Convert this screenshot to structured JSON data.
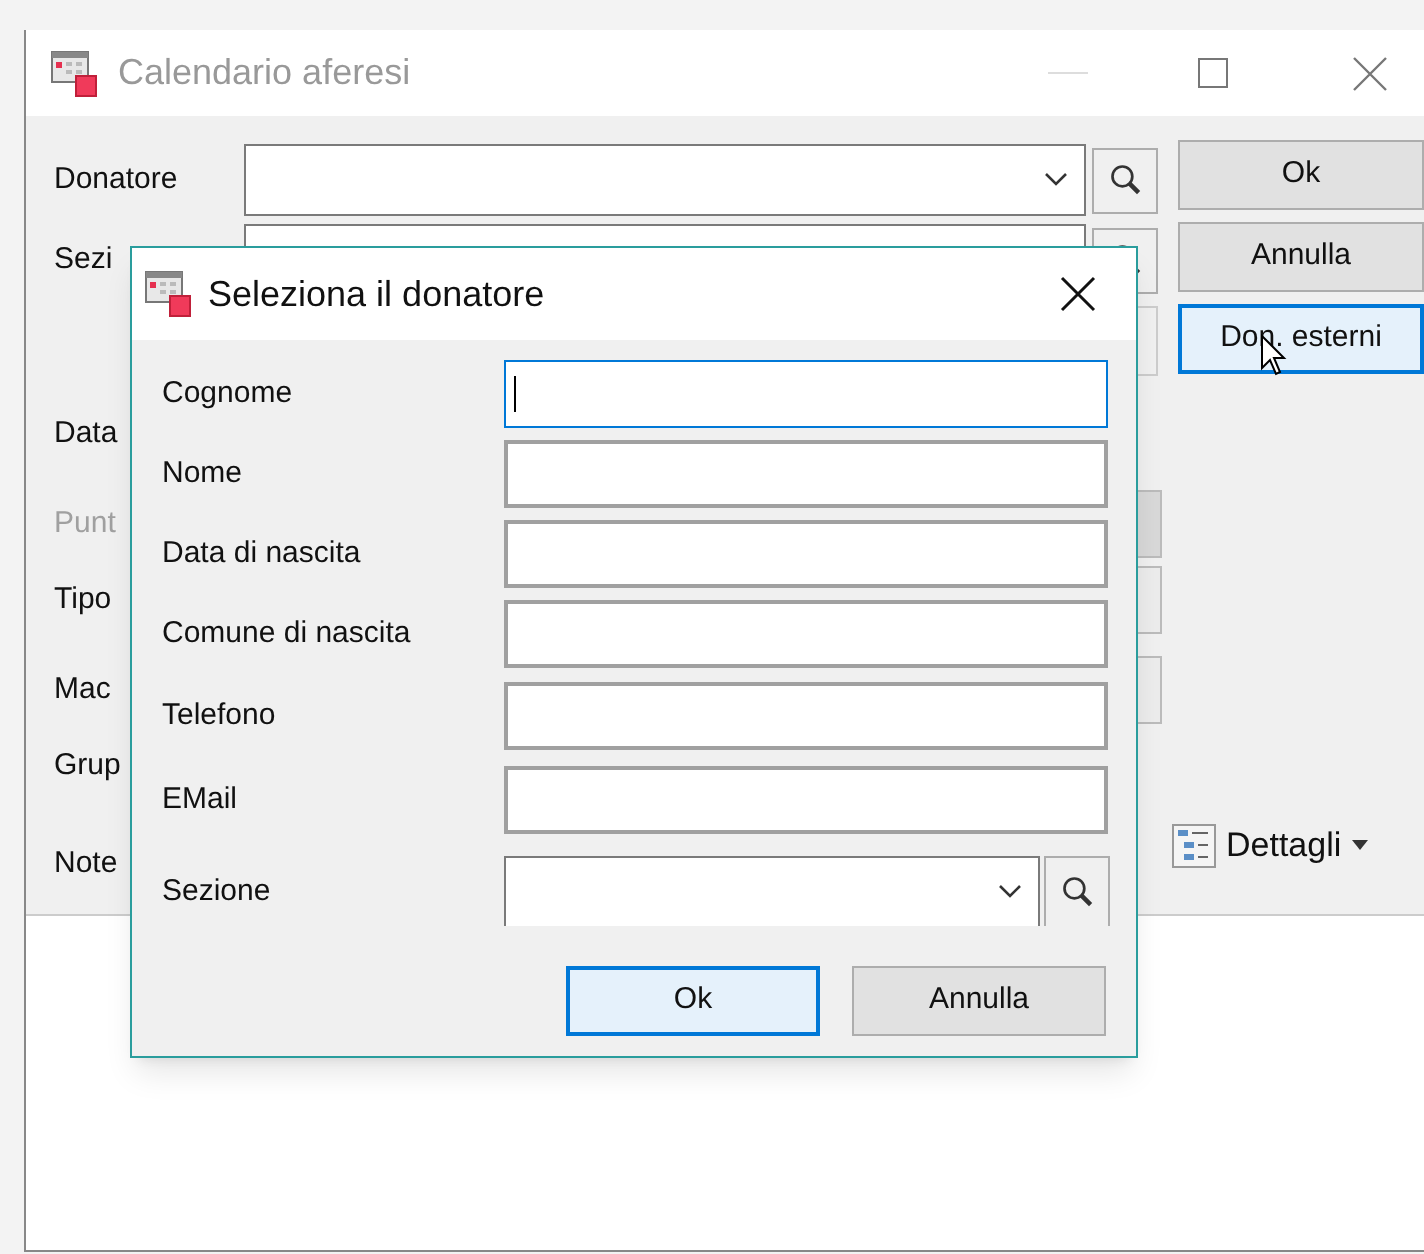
{
  "main_window": {
    "title": "Calendario aferesi",
    "labels": [
      {
        "text": "Donatore",
        "disabled": false
      },
      {
        "text": "Sezi",
        "disabled": false
      },
      {
        "text": "Data",
        "disabled": false
      },
      {
        "text": "Punt",
        "disabled": true
      },
      {
        "text": "Tipo",
        "disabled": false
      },
      {
        "text": "Mac",
        "disabled": false
      },
      {
        "text": "Grup",
        "disabled": false
      },
      {
        "text": "Note",
        "disabled": false
      }
    ],
    "buttons": [
      {
        "label": "Ok",
        "focused": false
      },
      {
        "label": "Annulla",
        "focused": false
      },
      {
        "label": "Don. esterni",
        "focused": true
      }
    ],
    "details_button": {
      "label": "Dettagli"
    }
  },
  "dialog": {
    "title": "Seleziona il donatore",
    "fields": [
      {
        "label": "Cognome",
        "kind": "text",
        "focused": true
      },
      {
        "label": "Nome",
        "kind": "text",
        "focused": false
      },
      {
        "label": "Data di nascita",
        "kind": "text",
        "focused": false
      },
      {
        "label": "Comune di nascita",
        "kind": "text",
        "focused": false
      },
      {
        "label": "Telefono",
        "kind": "text",
        "focused": false
      },
      {
        "label": "EMail",
        "kind": "text",
        "focused": false
      },
      {
        "label": "Sezione",
        "kind": "combo",
        "focused": false
      }
    ],
    "buttons": [
      {
        "label": "Ok",
        "focused": true
      },
      {
        "label": "Annulla",
        "focused": false
      }
    ]
  }
}
